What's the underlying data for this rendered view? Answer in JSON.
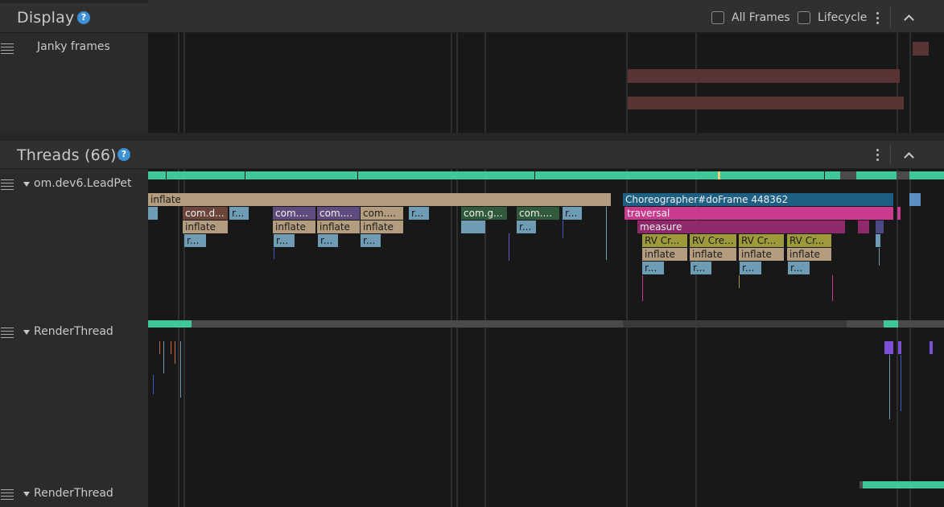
{
  "display": {
    "title": "Display",
    "help_icon": "help-circle-icon",
    "all_frames_label": "All Frames",
    "lifecycle_label": "Lifecycle",
    "track_label": "Janky frames"
  },
  "threads": {
    "title": "Threads (66)",
    "help_icon": "help-circle-icon",
    "tracks": [
      {
        "label": "om.dev6.LeadPet"
      },
      {
        "label": "RenderThread"
      },
      {
        "label": "RenderThread"
      }
    ]
  },
  "slices": {
    "inflate_top": "inflate",
    "choreographer": "Choreographer#doFrame 448362",
    "traversal": "traversal",
    "measure": "measure",
    "com_d": "com.d...",
    "r_dots": "r...",
    "com_4": "com....",
    "com_g": "com.g...",
    "inflate": "inflate",
    "rv_cr1": "RV Cr...",
    "rv_cre": "RV Cre...",
    "rv_cr2": "RV Cr..."
  },
  "colors": {
    "header_bg": "#303030",
    "canvas_bg": "#181818",
    "accent_blue": "#3d8fd6",
    "jank_red": "#5a3434",
    "thread_green": "#3fc79a",
    "inflate_tan": "#b39d7e",
    "choreographer_blue": "#1d5f82",
    "traversal_pink": "#c93b8f",
    "measure_magenta": "#8e2a6b",
    "rv_olive": "#9d9a3c"
  }
}
